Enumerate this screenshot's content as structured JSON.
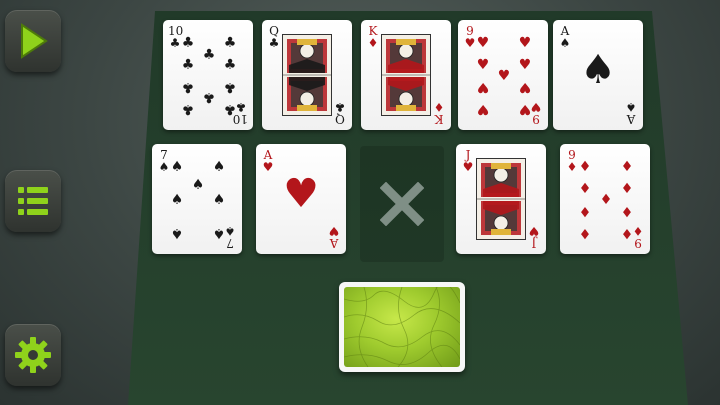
{
  "colors": {
    "felt": "#233e2b",
    "accent_green": "#8fd21b",
    "card_red": "#b3161b",
    "card_black": "#1a1a1a",
    "deck_back": "#9fcb2e"
  },
  "sidebar": {
    "play_icon": "play-icon",
    "menu_icon": "menu-icon",
    "settings_icon": "gear-icon"
  },
  "empty_slot": {
    "icon": "x-mark-icon"
  },
  "cards_row1": [
    {
      "rank": "10",
      "suit": "♣",
      "color": "black"
    },
    {
      "rank": "Q",
      "suit": "♣",
      "color": "black"
    },
    {
      "rank": "K",
      "suit": "♦",
      "color": "red"
    },
    {
      "rank": "9",
      "suit": "♥",
      "color": "red"
    },
    {
      "rank": "A",
      "suit": "♠",
      "color": "black"
    }
  ],
  "cards_row2": [
    {
      "rank": "7",
      "suit": "♠",
      "color": "black"
    },
    {
      "rank": "A",
      "suit": "♥",
      "color": "red"
    },
    {
      "rank": "J",
      "suit": "♥",
      "color": "red"
    },
    {
      "rank": "9",
      "suit": "♦",
      "color": "red"
    }
  ]
}
